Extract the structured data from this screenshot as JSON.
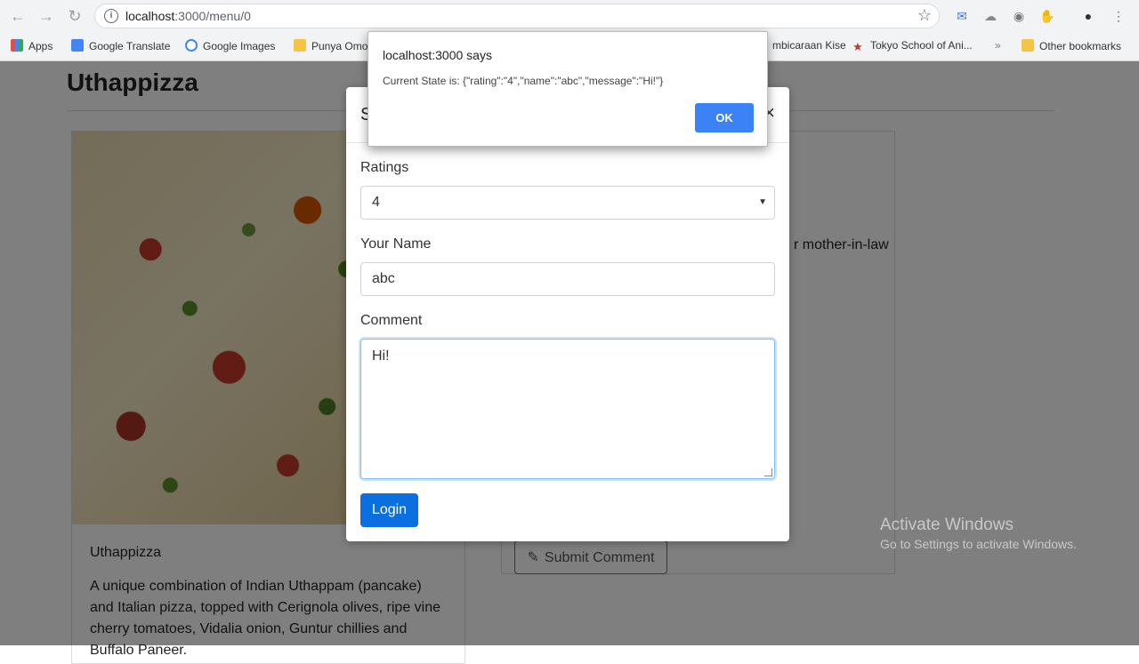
{
  "browser": {
    "url_host": "localhost",
    "url_path": ":3000/menu/0",
    "bookmarks": [
      {
        "label": "Apps",
        "color": "#e74c3c"
      },
      {
        "label": "Google Translate",
        "color": "#4285f4"
      },
      {
        "label": "Google Images",
        "color": "#34a853"
      },
      {
        "label": "Punya Omo",
        "color": "#f4c542"
      },
      {
        "label": "mbicaraan Kise",
        "color": "#f4c542"
      },
      {
        "label": "Tokyo School of Ani...",
        "color": "#c0392b"
      },
      {
        "label": "Other bookmarks",
        "color": "#f4c542"
      }
    ],
    "overflow_label": "»"
  },
  "page": {
    "title": "Uthappizza",
    "card_title": "Uthappizza",
    "card_text": "A unique combination of Indian Uthappam (pancake) and Italian pizza, topped with Cerignola olives, ripe vine cherry tomatoes, Vidalia onion, Guntur chillies and Buffalo Paneer.",
    "right_text": "r mother-in-law",
    "submit_label": "Submit Comment"
  },
  "modal": {
    "title_initial": "S",
    "close": "×",
    "ratings_label": "Ratings",
    "ratings_value": "4",
    "name_label": "Your Name",
    "name_value": "abc",
    "comment_label": "Comment",
    "comment_value": "Hi!",
    "login_label": "Login"
  },
  "alert": {
    "title": "localhost:3000 says",
    "message": "Current State is: {\"rating\":\"4\",\"name\":\"abc\",\"message\":\"Hi!\"}",
    "ok_label": "OK"
  },
  "watermark": {
    "line1": "Activate Windows",
    "line2": "Go to Settings to activate Windows."
  }
}
